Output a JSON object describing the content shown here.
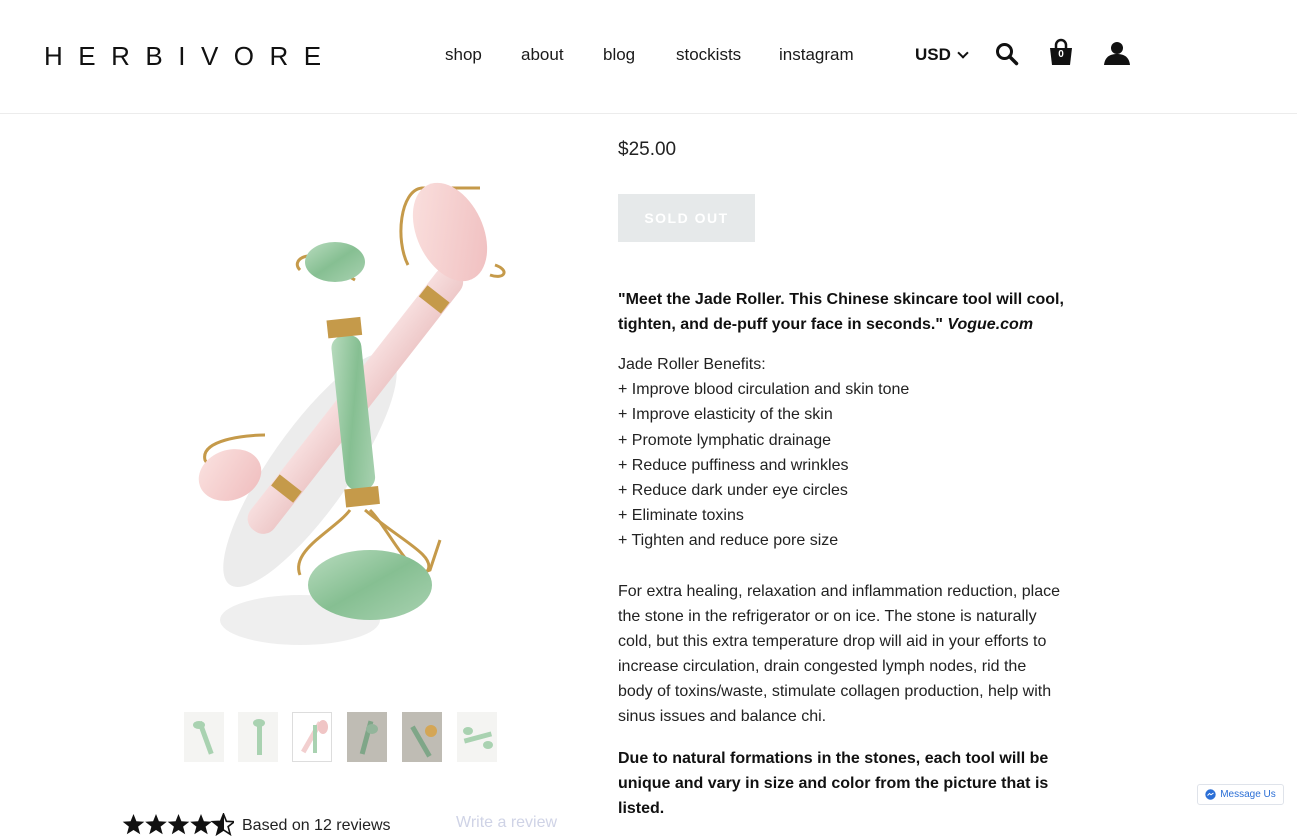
{
  "brand": {
    "logo": "HERBIVORE"
  },
  "nav": {
    "items": [
      {
        "label": "shop"
      },
      {
        "label": "about"
      },
      {
        "label": "blog"
      },
      {
        "label": "stockists"
      },
      {
        "label": "instagram"
      }
    ],
    "currency": "USD",
    "cart_count": "0",
    "icons": [
      "search-icon",
      "cart-icon",
      "account-icon"
    ]
  },
  "product": {
    "price": "$25.00",
    "button_label": "SOLD OUT",
    "quote": "\"Meet the Jade Roller. This Chinese skincare tool will cool, tighten, and de-puff your face in seconds.\"",
    "quote_source": "Vogue.com",
    "benefits_title": "Jade Roller Benefits:",
    "benefits": [
      "+ Improve blood circulation and skin tone",
      "+ Improve elasticity of the skin",
      "+ Promote lymphatic drainage",
      "+ Reduce puffiness and wrinkles",
      "+ Reduce dark under eye circles",
      "+ Eliminate toxins",
      "+ Tighten and reduce pore size"
    ],
    "description": "For extra healing, relaxation and inflammation reduction, place the stone in the refrigerator or on ice. The stone is naturally cold, but this extra temperature drop will aid in your efforts to increase circulation, drain congested lymph nodes, rid the body of toxins/waste, stimulate collagen production, help with sinus issues and balance chi.",
    "note": "Due to natural formations in the stones, each tool will be unique and vary in size and color from the picture that is listed.",
    "thumbnail_count": 6,
    "active_thumbnail": 3
  },
  "reviews": {
    "rating": 4.5,
    "summary": "Based on 12 reviews",
    "write_label": "Write a review"
  },
  "messenger": {
    "label": "Message Us"
  },
  "colors": {
    "text": "#111111",
    "sold_out_bg": "#e6e9ea",
    "jade": "#8fc39a",
    "rose": "#f6d3d3",
    "gold": "#c59a4a",
    "messenger_blue": "#2b6fd6"
  }
}
